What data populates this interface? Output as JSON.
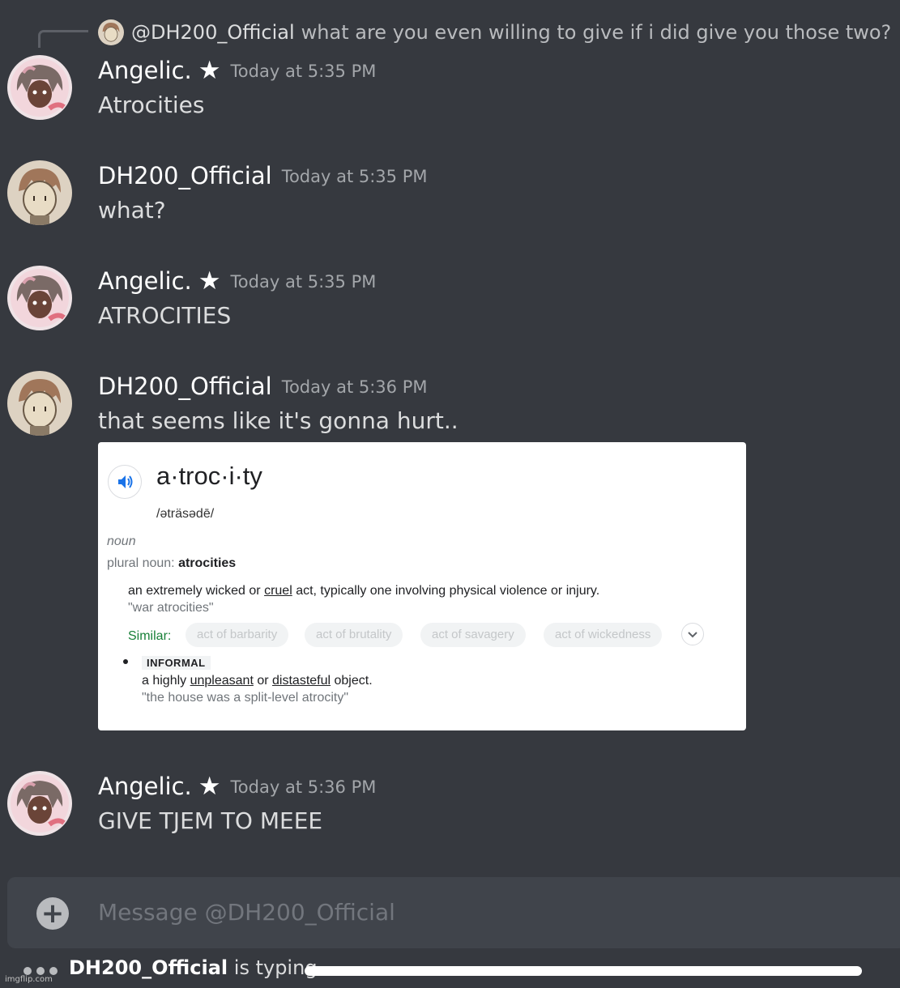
{
  "reply": {
    "mention": "@DH200_Official",
    "text": "what are you even willing to give if i did give you those two?"
  },
  "messages": [
    {
      "author": "Angelic.",
      "badge": "★",
      "time": "Today at 5:35 PM",
      "text": "Atrocities"
    },
    {
      "author": "DH200_Official",
      "badge": "",
      "time": "Today at 5:35 PM",
      "text": "what?"
    },
    {
      "author": "Angelic.",
      "badge": "★",
      "time": "Today at 5:35 PM",
      "text": "ATROCITIES"
    },
    {
      "author": "DH200_Official",
      "badge": "",
      "time": "Today at 5:36 PM",
      "text": "that seems like it's gonna hurt.."
    },
    {
      "author": "Angelic.",
      "badge": "★",
      "time": "Today at 5:36 PM",
      "text": "GIVE TJEM TO MEEE"
    }
  ],
  "embed": {
    "word": "a·troc·i·ty",
    "phonetic": "/əträsədē/",
    "part_of_speech": "noun",
    "plural_label": "plural noun",
    "plural_sep": ": ",
    "plural_value": "atrocities",
    "def1_pre": "an extremely wicked or ",
    "def1_link": "cruel",
    "def1_post": " act, typically one involving physical violence or injury.",
    "example1": "\"war atrocities\"",
    "similar_label": "Similar:",
    "similar": [
      "act of barbarity",
      "act of brutality",
      "act of savagery",
      "act of wickedness"
    ],
    "informal_tag": "INFORMAL",
    "def2_pre": "a highly ",
    "def2_link1": "unpleasant",
    "def2_mid": " or ",
    "def2_link2": "distasteful",
    "def2_post": " object.",
    "example2": "\"the house was a split-level atrocity\""
  },
  "input": {
    "placeholder": "Message @DH200_Official"
  },
  "typing": {
    "user": "DH200_Official",
    "text": " is typing"
  },
  "watermark": "imgflip.com",
  "colors": {
    "background": "#36393f",
    "input_background": "#40444b",
    "timestamp": "#a3a6aa",
    "similar_label": "#188038"
  },
  "icons": [
    "speaker-icon",
    "chevron-down-icon",
    "plus-icon",
    "typing-dots-icon"
  ]
}
